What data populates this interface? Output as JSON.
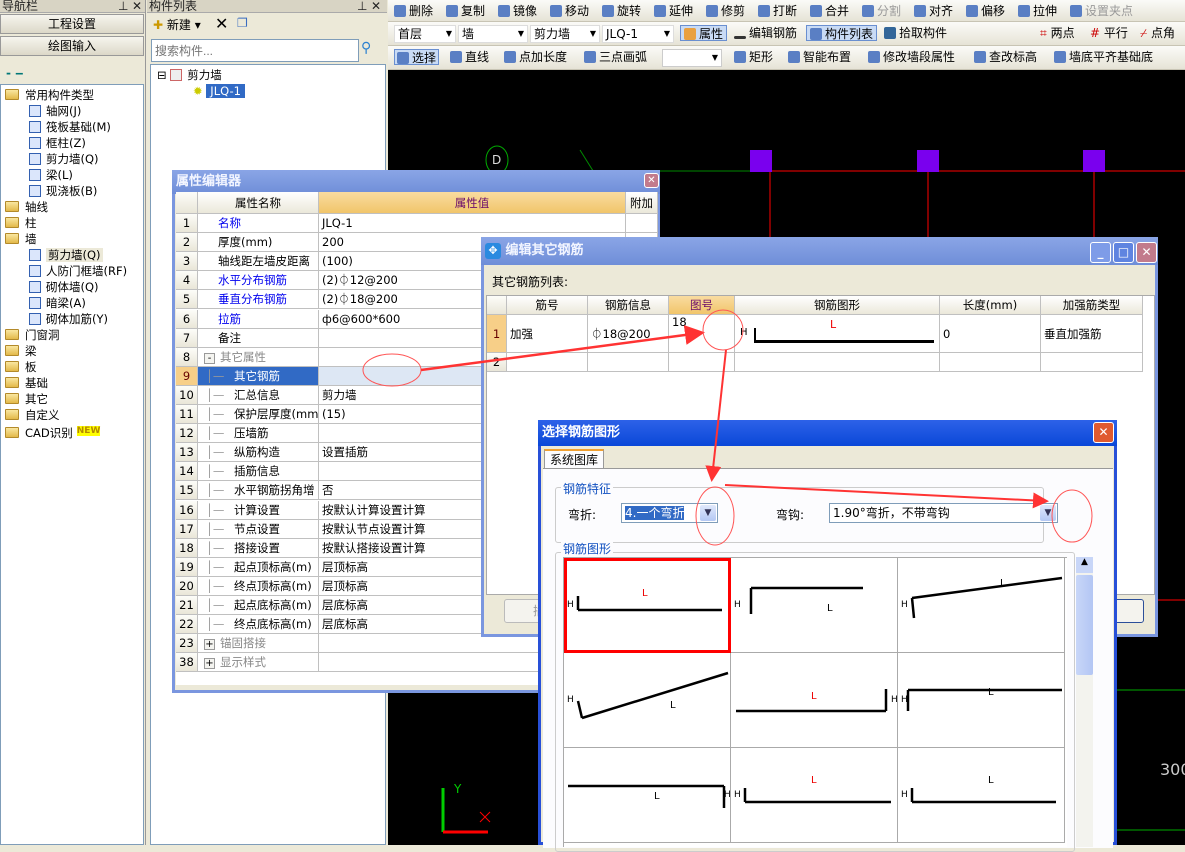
{
  "nav": {
    "title": "导航栏",
    "btn_project": "工程设置",
    "btn_draw": "绘图输入",
    "tree": [
      {
        "label": "常用构件类型",
        "level": 0,
        "folder": true
      },
      {
        "label": "轴网(J)",
        "level": 1
      },
      {
        "label": "筏板基础(M)",
        "level": 1
      },
      {
        "label": "框柱(Z)",
        "level": 1
      },
      {
        "label": "剪力墙(Q)",
        "level": 1
      },
      {
        "label": "梁(L)",
        "level": 1
      },
      {
        "label": "现浇板(B)",
        "level": 1
      },
      {
        "label": "轴线",
        "level": 0,
        "folder": true
      },
      {
        "label": "柱",
        "level": 0,
        "folder": true
      },
      {
        "label": "墙",
        "level": 0,
        "folder": true
      },
      {
        "label": "剪力墙(Q)",
        "level": 1,
        "selected": true
      },
      {
        "label": "人防门框墙(RF)",
        "level": 1
      },
      {
        "label": "砌体墙(Q)",
        "level": 1
      },
      {
        "label": "暗梁(A)",
        "level": 1
      },
      {
        "label": "砌体加筋(Y)",
        "level": 1
      },
      {
        "label": "门窗洞",
        "level": 0,
        "folder": true
      },
      {
        "label": "梁",
        "level": 0,
        "folder": true
      },
      {
        "label": "板",
        "level": 0,
        "folder": true
      },
      {
        "label": "基础",
        "level": 0,
        "folder": true
      },
      {
        "label": "其它",
        "level": 0,
        "folder": true
      },
      {
        "label": "自定义",
        "level": 0,
        "folder": true
      },
      {
        "label": "CAD识别",
        "level": 0,
        "folder": true,
        "badge": "NEW"
      }
    ]
  },
  "complist": {
    "title": "构件列表",
    "new_label": "新建",
    "search_placeholder": "搜索构件...",
    "root": "剪力墙",
    "child": "JLQ-1"
  },
  "toolbar1": [
    "删除",
    "复制",
    "镜像",
    "移动",
    "旋转",
    "延伸",
    "修剪",
    "打断",
    "合并",
    "分割",
    "对齐",
    "偏移",
    "拉伸",
    "设置夹点"
  ],
  "toolbar2": {
    "floor": "首层",
    "type": "墙",
    "subtype": "剪力墙",
    "name": "JLQ-1",
    "buttons": [
      "属性",
      "编辑钢筋",
      "构件列表",
      "拾取构件"
    ],
    "right": [
      "两点",
      "平行",
      "点角"
    ]
  },
  "toolbar3": [
    "选择",
    "直线",
    "点加长度",
    "三点画弧",
    "",
    "矩形",
    "智能布置",
    "修改墙段属性",
    "查改标高",
    "墙底平齐基础底"
  ],
  "canvas": {
    "axis_label": "D",
    "dim_text": "300",
    "axis_y": "Y"
  },
  "props": {
    "title": "属性编辑器",
    "headers": [
      "属性名称",
      "属性值",
      "附加"
    ],
    "rows": [
      {
        "n": "1",
        "name": "名称",
        "value": "JLQ-1",
        "blue": true
      },
      {
        "n": "2",
        "name": "厚度(mm)",
        "value": "200"
      },
      {
        "n": "3",
        "name": "轴线距左墙皮距离",
        "value": "(100)"
      },
      {
        "n": "4",
        "name": "水平分布钢筋",
        "value": "(2)⏀12@200",
        "blue": true
      },
      {
        "n": "5",
        "name": "垂直分布钢筋",
        "value": "(2)⏀18@200",
        "blue": true
      },
      {
        "n": "6",
        "name": "拉筋",
        "value": "ф6@600*600",
        "blue": true
      },
      {
        "n": "7",
        "name": "备注",
        "value": ""
      },
      {
        "n": "8",
        "name": "其它属性",
        "value": "",
        "group": "-"
      },
      {
        "n": "9",
        "name": "其它钢筋",
        "value": "",
        "child": true,
        "selected": true
      },
      {
        "n": "10",
        "name": "汇总信息",
        "value": "剪力墙",
        "child": true
      },
      {
        "n": "11",
        "name": "保护层厚度(mm)",
        "value": "(15)",
        "child": true
      },
      {
        "n": "12",
        "name": "压墙筋",
        "value": "",
        "child": true
      },
      {
        "n": "13",
        "name": "纵筋构造",
        "value": "设置插筋",
        "child": true
      },
      {
        "n": "14",
        "name": "插筋信息",
        "value": "",
        "child": true
      },
      {
        "n": "15",
        "name": "水平钢筋拐角增",
        "value": "否",
        "child": true
      },
      {
        "n": "16",
        "name": "计算设置",
        "value": "按默认计算设置计算",
        "child": true
      },
      {
        "n": "17",
        "name": "节点设置",
        "value": "按默认节点设置计算",
        "child": true
      },
      {
        "n": "18",
        "name": "搭接设置",
        "value": "按默认搭接设置计算",
        "child": true
      },
      {
        "n": "19",
        "name": "起点顶标高(m)",
        "value": "层顶标高",
        "child": true
      },
      {
        "n": "20",
        "name": "终点顶标高(m)",
        "value": "层顶标高",
        "child": true
      },
      {
        "n": "21",
        "name": "起点底标高(m)",
        "value": "层底标高",
        "child": true
      },
      {
        "n": "22",
        "name": "终点底标高(m)",
        "value": "层底标高",
        "child": true
      },
      {
        "n": "23",
        "name": "锚固搭接",
        "value": "",
        "group": "+"
      },
      {
        "n": "38",
        "name": "显示样式",
        "value": "",
        "group": "+"
      }
    ]
  },
  "edit": {
    "title": "编辑其它钢筋",
    "list_label": "其它钢筋列表:",
    "headers": [
      "筋号",
      "钢筋信息",
      "图号",
      "钢筋图形",
      "长度(mm)",
      "加强筋类型"
    ],
    "rows": [
      {
        "n": "1",
        "no": "加强",
        "info": "⏀18@200",
        "fig": "18",
        "len": "0",
        "type": "垂直加强筋"
      },
      {
        "n": "2"
      }
    ],
    "shape_h": "H",
    "shape_l": "L",
    "ellipsis": "...",
    "insert_btn": "插"
  },
  "select": {
    "title": "选择钢筋图形",
    "tab": "系统图库",
    "group1": "钢筋特征",
    "bend_label": "弯折:",
    "bend_value": "4.一个弯折",
    "hook_label": "弯钩:",
    "hook_value": "1.90°弯折，不带弯钩",
    "group2": "钢筋图形"
  },
  "colors": {
    "accent_red": "#ff3b3b",
    "selected_blue": "#316ac5",
    "title_blue": "#7a96df",
    "canvas_bg": "#000000"
  }
}
